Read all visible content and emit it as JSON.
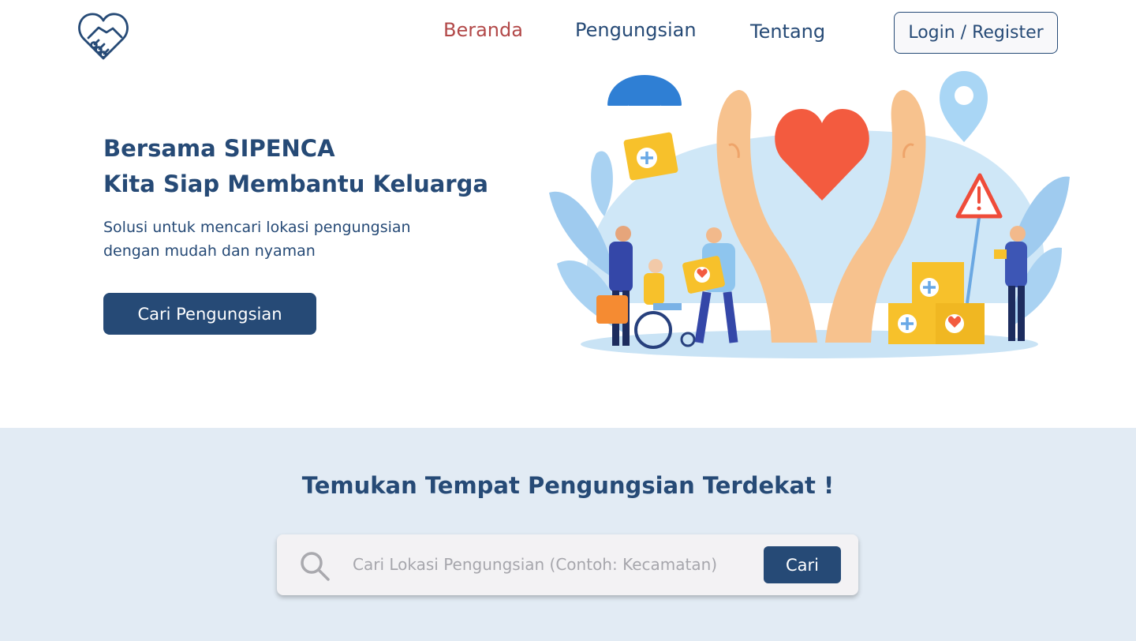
{
  "nav": {
    "logo_icon": "heart-handshake-icon",
    "links": [
      {
        "label": "Beranda",
        "active": true
      },
      {
        "label": "Pengungsian",
        "active": false
      },
      {
        "label": "Tentang",
        "active": false
      }
    ],
    "login_label": "Login / Register"
  },
  "hero": {
    "title_line1": "Bersama SIPENCA",
    "title_line2": "Kita Siap Membantu Keluarga",
    "subtitle_line1": "Solusi untuk mencari lokasi pengungsian",
    "subtitle_line2": "dengan mudah dan nyaman",
    "cta_label": "Cari Pengungsian",
    "illustration": "caring-hands-heart-aid-illustration"
  },
  "search": {
    "title": "Temukan Tempat Pengungsian Terdekat !",
    "placeholder": "Cari Lokasi Pengungsian (Contoh: Kecamatan)",
    "value": "",
    "button_label": "Cari",
    "icon": "search-icon"
  },
  "colors": {
    "primary": "#264a76",
    "active_link": "#b24848",
    "section_bg": "#e2ebf4",
    "search_box_bg": "#f3f2f4"
  }
}
